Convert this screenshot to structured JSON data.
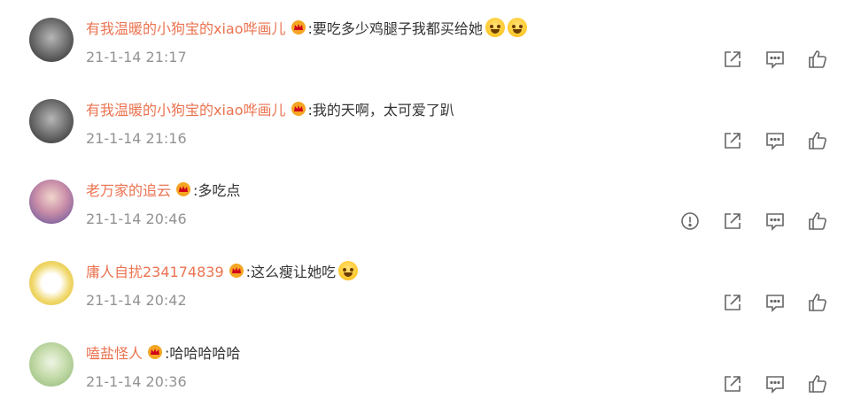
{
  "comments": [
    {
      "username": "有我温暖的小狗宝的xiao哗画儿",
      "text": ":要吃多少鸡腿子我都买给她",
      "time": "21-1-14 21:17",
      "avatar": "dark-photo-avatar",
      "emojis": [
        "crying-face-emoji",
        "crying-face-emoji"
      ],
      "has_report": false
    },
    {
      "username": "有我温暖的小狗宝的xiao哗画儿",
      "text": ":我的天啊，太可爱了趴",
      "time": "21-1-14 21:16",
      "avatar": "dark-photo-avatar",
      "emojis": [],
      "has_report": false
    },
    {
      "username": "老万家的追云",
      "text": ":多吃点",
      "time": "21-1-14 20:46",
      "avatar": "girl-photo-avatar",
      "emojis": [],
      "has_report": true
    },
    {
      "username": "庸人自扰234174839",
      "text": ":这么瘦让她吃",
      "time": "21-1-14 20:42",
      "avatar": "cartoon-avatar",
      "emojis": [
        "laughing-face-emoji"
      ],
      "has_report": false
    },
    {
      "username": "嗑盐怪人",
      "text": ":哈哈哈哈哈",
      "time": "21-1-14 20:36",
      "avatar": "green-plant-avatar",
      "emojis": [],
      "has_report": false
    }
  ],
  "colors": {
    "username": "#eb7350",
    "text": "#333333",
    "time": "#939393",
    "icon": "#666666",
    "crown": "#f5a623"
  },
  "icons": [
    "report-icon",
    "share-icon",
    "comment-icon",
    "like-icon",
    "vip-crown-icon"
  ]
}
